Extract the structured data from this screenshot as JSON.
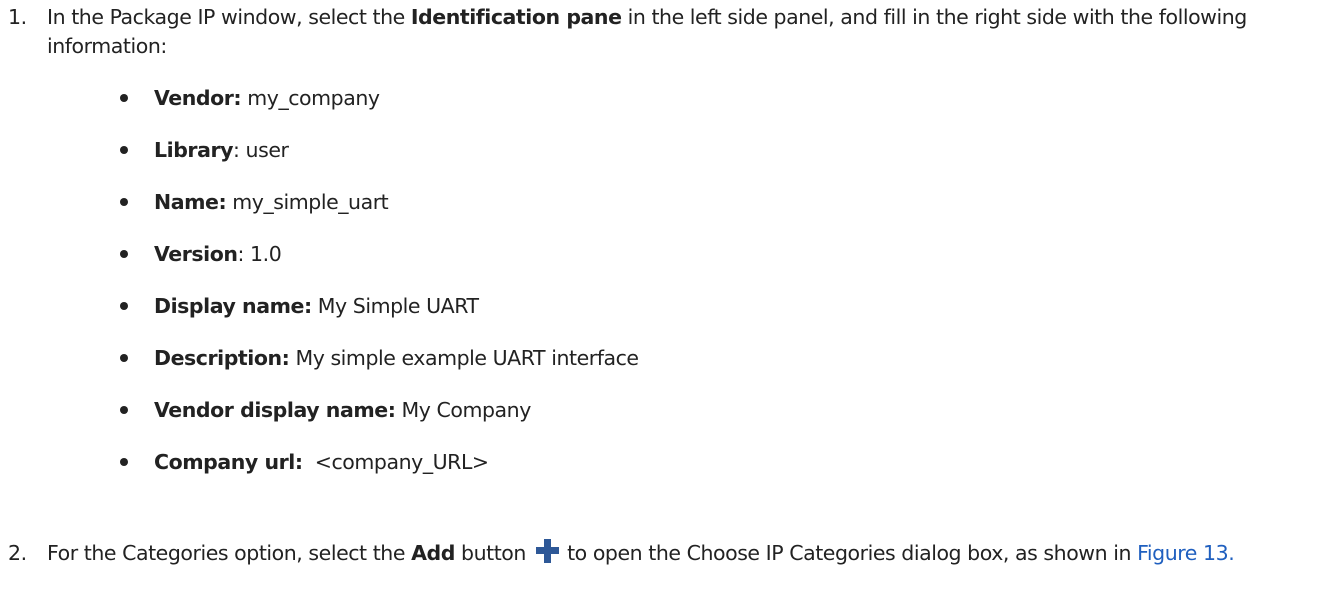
{
  "step1": {
    "number": "1.",
    "text_before": "In the Package IP window, select the ",
    "bold": "Identification pane",
    "text_after": " in the left side panel, and fill in the right side with the following information:"
  },
  "fields": [
    {
      "label": "Vendor:",
      "value": " my_company"
    },
    {
      "label": "Library",
      "value": ": user"
    },
    {
      "label": "Name:",
      "value": " my_simple_uart"
    },
    {
      "label": "Version",
      "value": ": 1.0"
    },
    {
      "label": "Display name:",
      "value": " My Simple UART"
    },
    {
      "label": "Description:",
      "value": " My simple example UART interface"
    },
    {
      "label": "Vendor display name:",
      "value": " My Company"
    },
    {
      "label": "Company url:",
      "value": "  <company_URL>"
    }
  ],
  "step2": {
    "number": "2.",
    "text_before": "For the Categories option, select the ",
    "bold": "Add",
    "text_mid": " button ",
    "text_after": " to open the Choose IP Categories dialog box, as shown in ",
    "link": "Figure 13.",
    "icon": "plus-icon",
    "icon_color": "#2e5897",
    "link_color": "#1f5fbf"
  }
}
